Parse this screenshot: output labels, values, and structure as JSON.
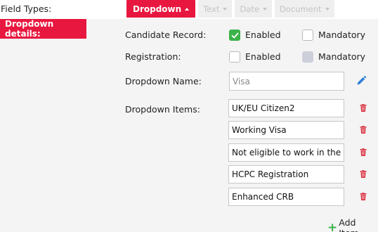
{
  "field_types": {
    "label": "Field Types:",
    "tabs": [
      {
        "label": "Dropdown"
      },
      {
        "label": "Text"
      },
      {
        "label": "Date"
      },
      {
        "label": "Document"
      }
    ]
  },
  "details": {
    "tag": "Dropdown details:",
    "candidate_record": {
      "label": "Candidate Record:",
      "enabled": {
        "label": "Enabled",
        "checked": true
      },
      "mandatory": {
        "label": "Mandatory",
        "checked": false
      }
    },
    "registration": {
      "label": "Registration:",
      "enabled": {
        "label": "Enabled",
        "checked": false
      },
      "mandatory": {
        "label": "Mandatory",
        "checked": false,
        "disabled": true
      }
    },
    "dropdown_name": {
      "label": "Dropdown Name:",
      "value": "Visa"
    },
    "dropdown_items": {
      "label": "Dropdown Items:",
      "items": [
        "UK/EU Citizen2",
        "Working Visa",
        "Not eligible to work in the U",
        "HCPC Registration",
        "Enhanced CRB"
      ]
    },
    "add_item": "Add Item"
  },
  "colors": {
    "accent": "#e8173f",
    "check_green": "#3bb34a",
    "edit_blue": "#2f7fd6",
    "delete_red": "#d9303f"
  },
  "icons": {
    "edit": "pencil-icon",
    "delete": "trash-icon",
    "add": "plus-icon",
    "caret_active": "caret-up-icon",
    "caret_inactive": "caret-down-icon"
  }
}
